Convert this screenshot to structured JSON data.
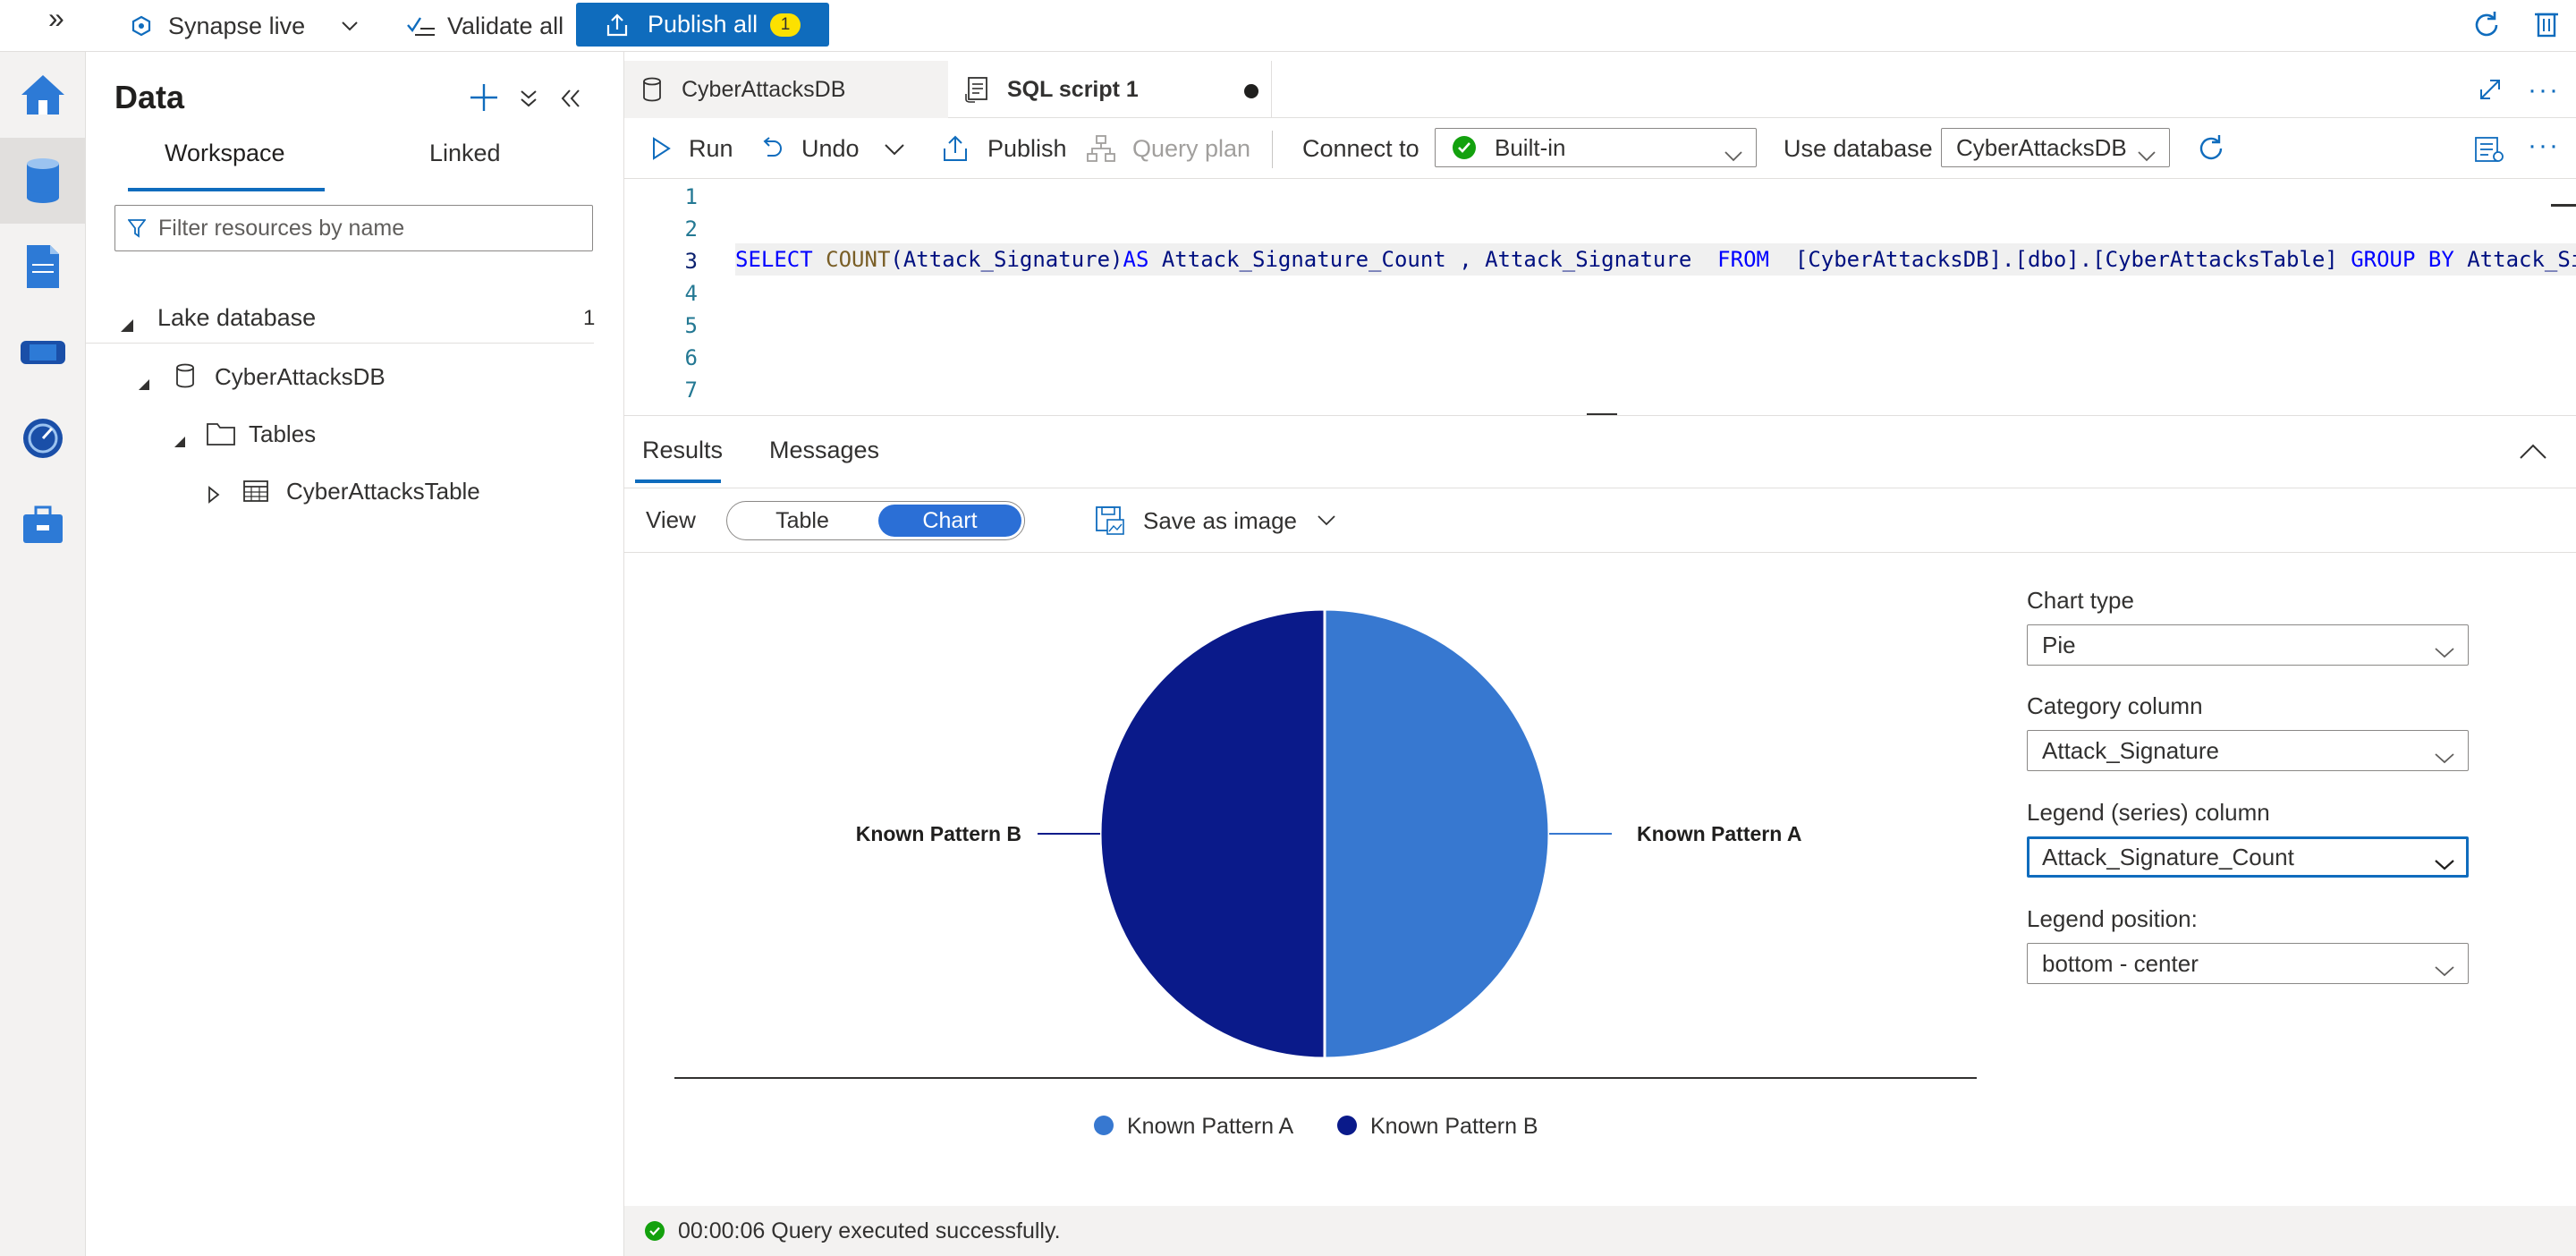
{
  "topbar": {
    "workspace_mode": "Synapse live",
    "validate_label": "Validate all",
    "publish_label": "Publish all",
    "publish_count": "1"
  },
  "panel": {
    "title": "Data",
    "tabs": [
      {
        "label": "Workspace",
        "active": true
      },
      {
        "label": "Linked",
        "active": false
      }
    ],
    "filter_placeholder": "Filter resources by name",
    "section": {
      "label": "Lake database",
      "count": "1"
    },
    "tree": [
      {
        "label": "CyberAttacksDB",
        "level": 1,
        "icon": "database-icon"
      },
      {
        "label": "Tables",
        "level": 2,
        "icon": "folder-icon"
      },
      {
        "label": "CyberAttacksTable",
        "level": 3,
        "icon": "table-icon"
      }
    ]
  },
  "editor": {
    "tabs": [
      {
        "label": "CyberAttacksDB",
        "icon": "database-icon",
        "active": false
      },
      {
        "label": "SQL script 1",
        "icon": "script-icon",
        "active": true,
        "unsaved": true
      }
    ],
    "toolbar": {
      "run": "Run",
      "undo": "Undo",
      "publish": "Publish",
      "query_plan": "Query plan",
      "connect_to_label": "Connect to",
      "connect_to_value": "Built-in",
      "use_database_label": "Use database",
      "use_database_value": "CyberAttacksDB"
    },
    "line_numbers": [
      "1",
      "2",
      "3",
      "4",
      "5",
      "6",
      "7"
    ],
    "code_tokens": {
      "select": "SELECT",
      "count": "COUNT",
      "arg": "(Attack_Signature)",
      "as": "AS",
      "alias": " Attack_Signature_Count , Attack_Signature  ",
      "from": "FROM",
      "table": "  [CyberAttacksDB].[dbo].[CyberAttacksTable] ",
      "group_by": "GROUP BY",
      "tail": " Attack_Si"
    }
  },
  "results": {
    "tabs": [
      {
        "label": "Results",
        "active": true
      },
      {
        "label": "Messages",
        "active": false
      }
    ],
    "view_label": "View",
    "view_options": [
      "Table",
      "Chart"
    ],
    "view_selected": "Chart",
    "save_as_image": "Save as image",
    "status": "00:00:06 Query executed successfully."
  },
  "chart_settings": {
    "chart_type_label": "Chart type",
    "chart_type_value": "Pie",
    "category_label": "Category column",
    "category_value": "Attack_Signature",
    "legend_series_label": "Legend (series) column",
    "legend_series_value": "Attack_Signature_Count",
    "legend_position_label": "Legend position:",
    "legend_position_value": "bottom - center"
  },
  "chart_data": {
    "type": "pie",
    "title": "",
    "categories": [
      "Known Pattern A",
      "Known Pattern B"
    ],
    "values": [
      50,
      50
    ],
    "colors": [
      "#3778d0",
      "#0a1a8a"
    ],
    "legend": "bottom-center"
  },
  "colors": {
    "accent": "#0f6cbd",
    "success": "#13a10e"
  }
}
